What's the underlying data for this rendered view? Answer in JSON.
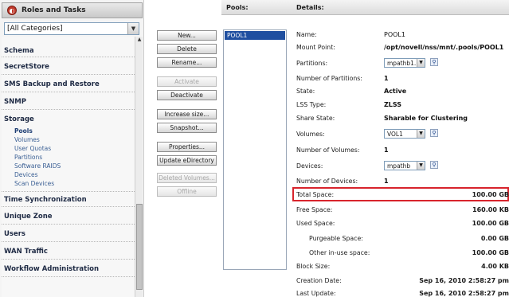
{
  "roles": {
    "title": "Roles and Tasks",
    "category": "[All Categories]",
    "groups": [
      {
        "label": "Schema"
      },
      {
        "label": "SecretStore"
      },
      {
        "label": "SMS Backup and Restore"
      },
      {
        "label": "SNMP"
      },
      {
        "label": "Storage"
      },
      {
        "label": "Time Synchronization"
      },
      {
        "label": "Unique Zone"
      },
      {
        "label": "Users"
      },
      {
        "label": "WAN Traffic"
      },
      {
        "label": "Workflow Administration"
      }
    ],
    "storage_items": [
      "Pools",
      "Volumes",
      "User Quotas",
      "Partitions",
      "Software RAIDS",
      "Devices",
      "Scan Devices"
    ]
  },
  "actions": {
    "new": "New...",
    "delete": "Delete",
    "rename": "Rename...",
    "activate": "Activate",
    "deactivate": "Deactivate",
    "increase_size": "Increase size...",
    "snapshot": "Snapshot...",
    "properties": "Properties...",
    "update_edirectory": "Update eDirectory",
    "deleted_volumes": "Deleted Volumes...",
    "offline": "Offline"
  },
  "pools": {
    "header": "Pools:",
    "items": [
      "POOL1"
    ]
  },
  "details": {
    "header": "Details:",
    "name_label": "Name:",
    "name_value": "POOL1",
    "mount_label": "Mount Point:",
    "mount_value": "/opt/novell/nss/mnt/.pools/POOL1",
    "partitions_label": "Partitions:",
    "partitions_value": "mpathb1.1",
    "num_partitions_label": "Number of Partitions:",
    "num_partitions_value": "1",
    "state_label": "State:",
    "state_value": "Active",
    "lss_label": "LSS Type:",
    "lss_value": "ZLSS",
    "share_label": "Share State:",
    "share_value": "Sharable for Clustering",
    "volumes_label": "Volumes:",
    "volumes_value": "VOL1",
    "num_volumes_label": "Number of Volumes:",
    "num_volumes_value": "1",
    "devices_label": "Devices:",
    "devices_value": "mpathb",
    "num_devices_label": "Number of Devices:",
    "num_devices_value": "1",
    "total_label": "Total Space:",
    "total_value": "100.00 GB",
    "free_label": "Free Space:",
    "free_value": "160.00 KB",
    "used_label": "Used Space:",
    "used_value": "100.00 GB",
    "purgeable_label": "Purgeable Space:",
    "purgeable_value": "0.00 GB",
    "other_label": "Other in-use space:",
    "other_value": "100.00 GB",
    "block_label": "Block Size:",
    "block_value": "4.00 KB",
    "creation_label": "Creation Date:",
    "creation_value": "Sep 16, 2010 2:58:27 pm",
    "update_label": "Last Update:",
    "update_value": "Sep 16, 2010 2:58:27 pm"
  }
}
